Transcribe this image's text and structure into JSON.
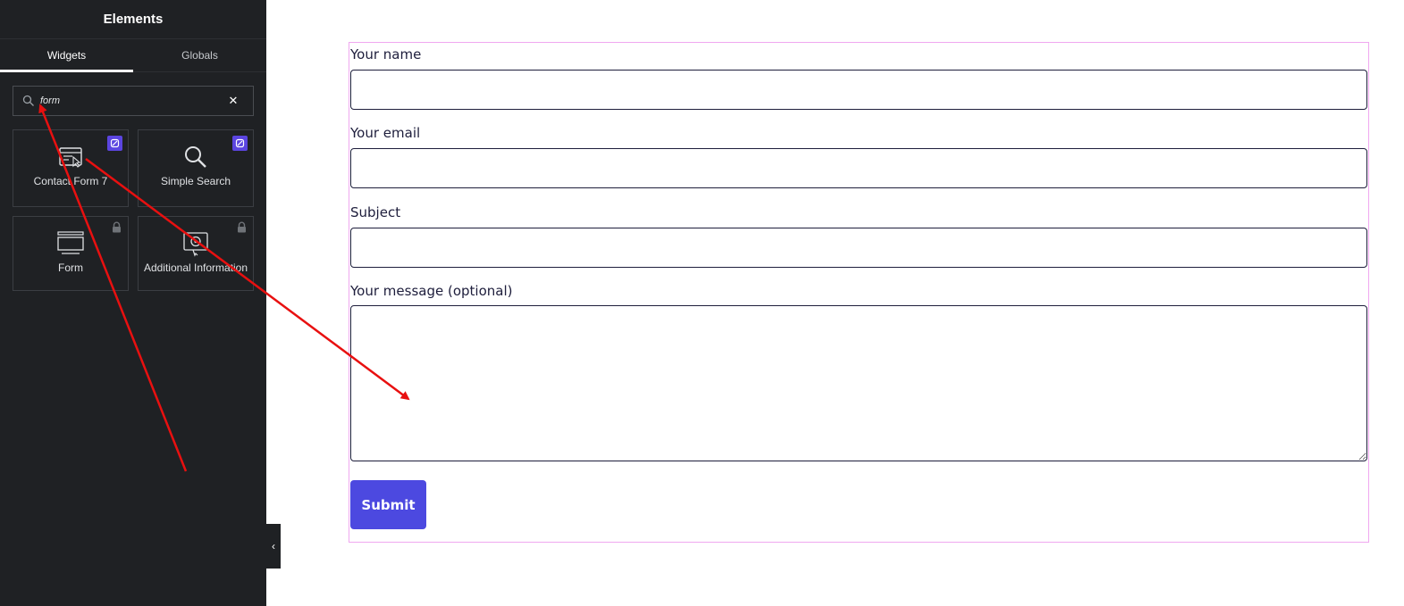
{
  "sidebar": {
    "title": "Elements",
    "tabs": [
      {
        "label": "Widgets",
        "active": true
      },
      {
        "label": "Globals",
        "active": false
      }
    ],
    "search": {
      "value": "form",
      "icon": "search-icon",
      "clear_icon": "close-icon"
    },
    "widgets": [
      {
        "label": "Contact Form 7",
        "icon": "contact-form-icon",
        "badge": "pro-badge-icon"
      },
      {
        "label": "Simple Search",
        "icon": "search-icon",
        "badge": "pro-badge-icon"
      },
      {
        "label": "Form",
        "icon": "form-icon",
        "badge": "lock-icon"
      },
      {
        "label": "Additional Information",
        "icon": "info-card-icon",
        "badge": "lock-icon"
      }
    ],
    "collapse_icon": "chevron-left-icon"
  },
  "form": {
    "fields": [
      {
        "label": "Your name"
      },
      {
        "label": "Your email"
      },
      {
        "label": "Subject"
      },
      {
        "label": "Your message (optional)"
      }
    ],
    "submit_label": "Submit"
  },
  "colors": {
    "sidebar_bg": "#1f2124",
    "accent": "#4c49e0",
    "badge": "#5b45e0",
    "frame_outline": "#f0a8f0",
    "annotation_arrow": "#e81010"
  }
}
